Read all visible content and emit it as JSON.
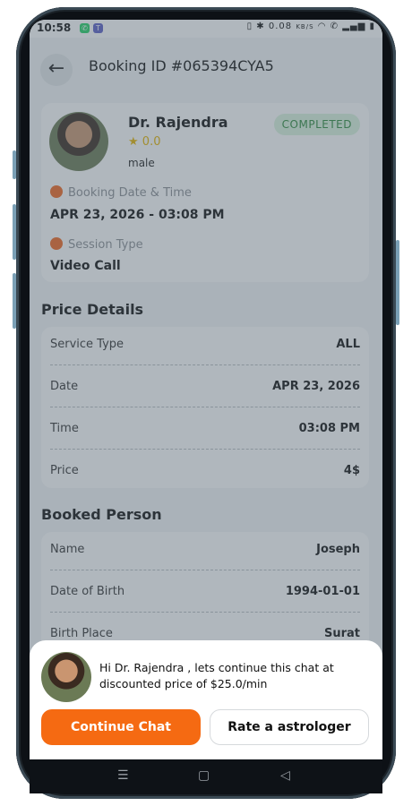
{
  "statusbar": {
    "time": "10:58",
    "net_speed": "0.08",
    "net_unit": "KB/S"
  },
  "header": {
    "title": "Booking ID #065394CYA5",
    "back_icon": "arrow-left-icon"
  },
  "booking": {
    "doctor_name": "Dr. Rajendra",
    "rating": "0.0",
    "gender": "male",
    "status": "COMPLETED",
    "datetime_label": "Booking Date & Time",
    "datetime_value": "APR 23, 2026 - 03:08 PM",
    "session_label": "Session Type",
    "session_value": "Video Call"
  },
  "price_details": {
    "title": "Price Details",
    "rows": [
      {
        "label": "Service Type",
        "value": "ALL"
      },
      {
        "label": "Date",
        "value": "APR 23, 2026"
      },
      {
        "label": "Time",
        "value": "03:08 PM"
      },
      {
        "label": "Price",
        "value": "4$"
      }
    ]
  },
  "booked_person": {
    "title": "Booked Person",
    "rows": [
      {
        "label": "Name",
        "value": "Joseph"
      },
      {
        "label": "Date of Birth",
        "value": "1994-01-01"
      },
      {
        "label": "Birth Place",
        "value": "Surat"
      }
    ]
  },
  "sheet": {
    "message": "Hi Dr. Rajendra , lets continue this chat at discounted price of $25.0/min",
    "continue_label": "Continue Chat",
    "rate_label": "Rate a astrologer"
  },
  "colors": {
    "accent": "#f56a12",
    "status_bg": "#daf4de",
    "status_text": "#2f8a3c",
    "star": "#e6b400"
  }
}
